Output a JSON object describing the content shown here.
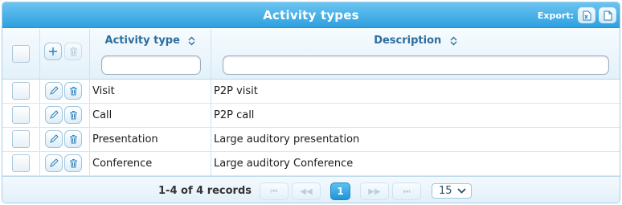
{
  "grid": {
    "title": "Activity types",
    "export_label": "Export:",
    "export_icons": [
      "excel-export-icon",
      "pdf-export-icon"
    ]
  },
  "header": {
    "columns": [
      {
        "label": "Activity type",
        "sort_icon": "sort-both-icon",
        "filter_value": ""
      },
      {
        "label": "Description",
        "sort_icon": "sort-both-icon",
        "filter_value": ""
      }
    ],
    "add_icon": "plus-icon",
    "delete_icon": "trash-icon"
  },
  "rows": [
    {
      "activity_type": "Visit",
      "description": "P2P visit"
    },
    {
      "activity_type": "Call",
      "description": "P2P call"
    },
    {
      "activity_type": "Presentation",
      "description": "Large auditory presentation"
    },
    {
      "activity_type": "Conference",
      "description": "Large auditory Conference"
    }
  ],
  "row_actions": {
    "edit_icon": "pencil-icon",
    "delete_icon": "trash-icon"
  },
  "footer": {
    "records_text": "1-4 of 4 records",
    "pager": {
      "first": "⏮",
      "prev": "◀◀",
      "current_page": "1",
      "next": "▶▶",
      "last": "⏭"
    },
    "page_size": "15"
  },
  "colors": {
    "title_bar": "#2ea0e0",
    "header_text": "#2c6e9e",
    "current_page": "#1f94d8",
    "border": "#a8cde7"
  }
}
